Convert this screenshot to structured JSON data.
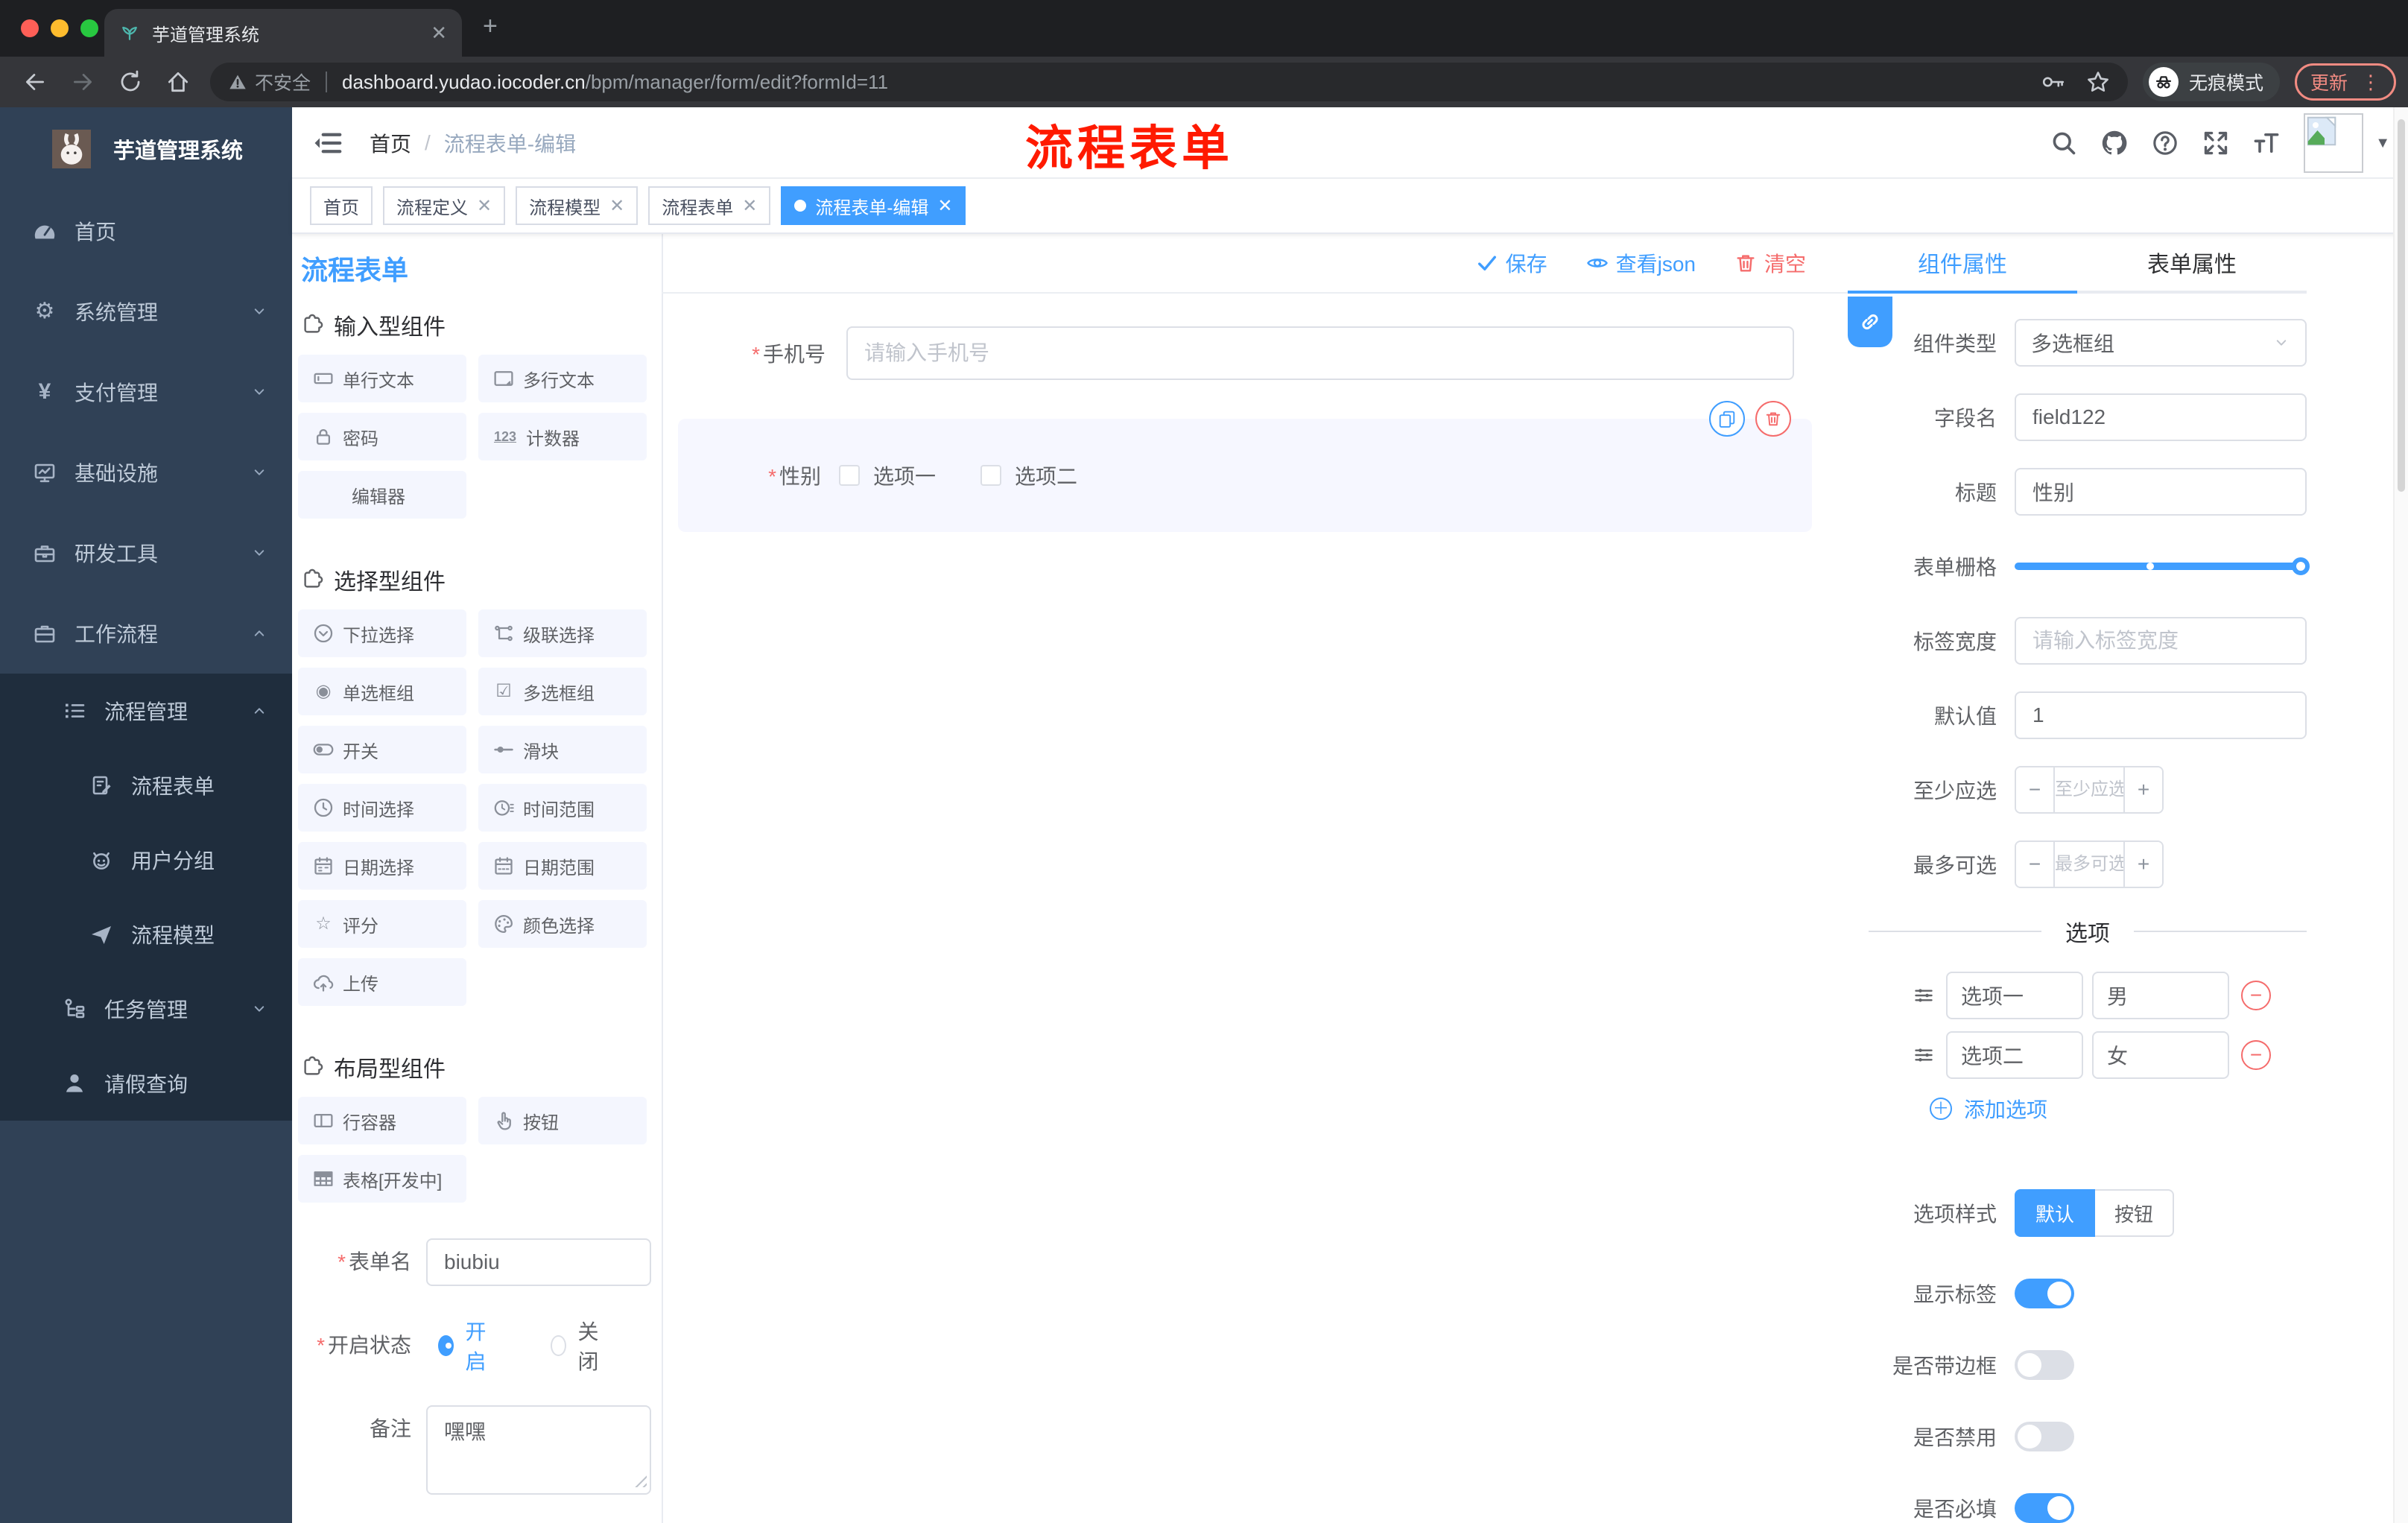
{
  "colors": {
    "accent": "#409EFF",
    "danger": "#F56C6C",
    "sidebar_bg": "#304156",
    "submenu_bg": "#1F2D3D",
    "tag_active": "#409EFF",
    "overlay_title": "#FF1A00"
  },
  "browser": {
    "tab_title": "芋道管理系统",
    "security_label": "不安全",
    "url_host": "dashboard.yudao.iocoder.cn",
    "url_path": "/bpm/manager/form/edit?formId=11",
    "incognito_label": "无痕模式",
    "update_label": "更新"
  },
  "sidebar": {
    "brand": "芋道管理系统",
    "items": [
      {
        "label": "首页",
        "icon": "dashboard-icon"
      },
      {
        "label": "系统管理",
        "icon": "gear-icon",
        "arrow": "down"
      },
      {
        "label": "支付管理",
        "icon": "yen-icon",
        "arrow": "down"
      },
      {
        "label": "基础设施",
        "icon": "monitor-icon",
        "arrow": "down"
      },
      {
        "label": "研发工具",
        "icon": "toolbox-icon",
        "arrow": "down"
      },
      {
        "label": "工作流程",
        "icon": "briefcase-icon",
        "arrow": "up"
      },
      {
        "label": "流程管理",
        "icon": "flow-list-icon",
        "arrow": "up",
        "level": 2
      },
      {
        "label": "流程表单",
        "icon": "form-doc-icon",
        "level": 3
      },
      {
        "label": "用户分组",
        "icon": "robot-icon",
        "level": 3
      },
      {
        "label": "流程模型",
        "icon": "paper-plane-icon",
        "level": 3
      },
      {
        "label": "任务管理",
        "icon": "task-tree-icon",
        "arrow": "down",
        "level": 2
      },
      {
        "label": "请假查询",
        "icon": "user-icon",
        "level": 2
      }
    ]
  },
  "header": {
    "breadcrumb_home": "首页",
    "breadcrumb_current": "流程表单-编辑",
    "overlay_title": "流程表单"
  },
  "tags_view": [
    {
      "label": "首页",
      "closable": false,
      "active": false
    },
    {
      "label": "流程定义",
      "closable": true,
      "active": false
    },
    {
      "label": "流程模型",
      "closable": true,
      "active": false
    },
    {
      "label": "流程表单",
      "closable": true,
      "active": false
    },
    {
      "label": "流程表单-编辑",
      "closable": true,
      "active": true
    }
  ],
  "designer": {
    "panel_title": "流程表单",
    "toolbar": {
      "save": "保存",
      "view_json": "查看json",
      "clear": "清空"
    },
    "sections": [
      {
        "title": "输入型组件",
        "items": [
          "单行文本",
          "多行文本",
          "密码",
          "计数器",
          "编辑器"
        ]
      },
      {
        "title": "选择型组件",
        "items": [
          "下拉选择",
          "级联选择",
          "单选框组",
          "多选框组",
          "开关",
          "滑块",
          "时间选择",
          "时间范围",
          "日期选择",
          "日期范围",
          "评分",
          "颜色选择",
          "上传"
        ]
      },
      {
        "title": "布局型组件",
        "items": [
          "行容器",
          "按钮",
          "表格[开发中]"
        ]
      }
    ],
    "meta": {
      "form_name_label": "表单名",
      "form_name_value": "biubiu",
      "status_label": "开启状态",
      "status_on": "开启",
      "status_off": "关闭",
      "status_selected": "开启",
      "remark_label": "备注",
      "remark_value": "嘿嘿"
    }
  },
  "canvas": {
    "phone_label": "手机号",
    "phone_placeholder": "请输入手机号",
    "gender_label": "性别",
    "gender_option1": "选项一",
    "gender_option2": "选项二"
  },
  "inspector": {
    "tab_component": "组件属性",
    "tab_form": "表单属性",
    "component_type_label": "组件类型",
    "component_type_value": "多选框组",
    "field_name_label": "字段名",
    "field_name_value": "field122",
    "title_label": "标题",
    "title_value": "性别",
    "grid_label": "表单栅格",
    "label_width_label": "标签宽度",
    "label_width_placeholder": "请输入标签宽度",
    "default_label": "默认值",
    "default_value": "1",
    "min_label": "至少应选",
    "min_placeholder": "至少应选",
    "max_label": "最多可选",
    "max_placeholder": "最多可选",
    "options_divider": "选项",
    "option_rows": [
      {
        "label": "选项一",
        "value": "男"
      },
      {
        "label": "选项二",
        "value": "女"
      }
    ],
    "add_option": "添加选项",
    "option_style_label": "选项样式",
    "style_default": "默认",
    "style_button": "按钮",
    "style_selected": "默认",
    "toggle_show_label": "显示标签",
    "toggle_show_on": true,
    "toggle_border": "是否带边框",
    "toggle_border_on": false,
    "toggle_disabled": "是否禁用",
    "toggle_disabled_on": false,
    "toggle_required": "是否必填",
    "toggle_required_on": true
  }
}
